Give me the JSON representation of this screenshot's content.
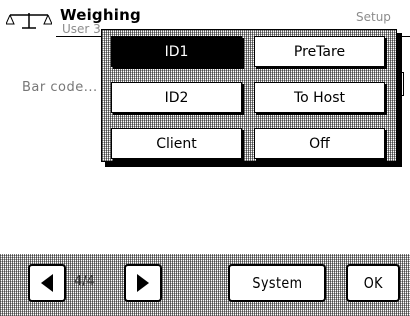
{
  "header": {
    "title": "Weighing",
    "user": "User 3",
    "mode": "Setup"
  },
  "content": {
    "row_label": "Bar code..."
  },
  "popup": {
    "options": [
      {
        "label": "ID1",
        "selected": true
      },
      {
        "label": "PreTare",
        "selected": false
      },
      {
        "label": "ID2",
        "selected": false
      },
      {
        "label": "To Host",
        "selected": false
      },
      {
        "label": "Client",
        "selected": false
      },
      {
        "label": "Off",
        "selected": false
      }
    ]
  },
  "footer": {
    "page_indicator": "4/4",
    "system_label": "System",
    "ok_label": "OK"
  }
}
